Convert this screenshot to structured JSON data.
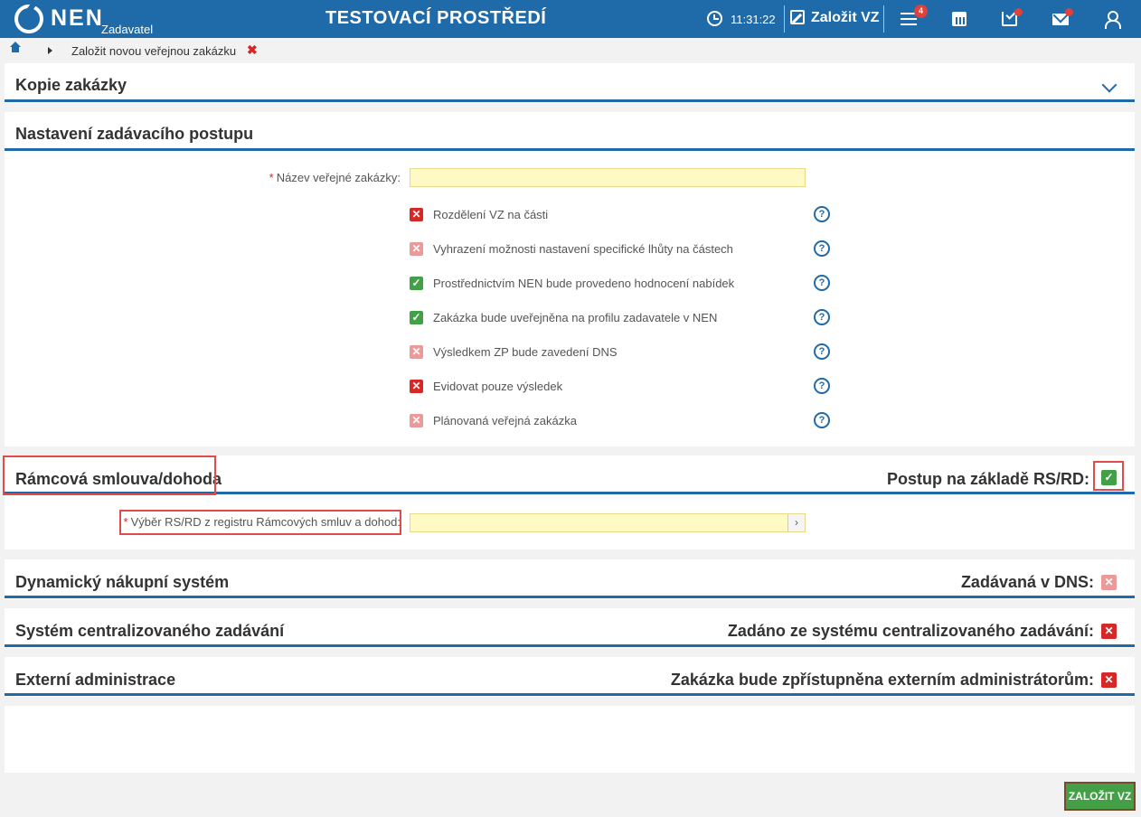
{
  "header": {
    "brand": "NEN",
    "brand_sub": "Zadavatel",
    "environment": "TESTOVACÍ PROSTŘEDÍ",
    "time": "11:31:22",
    "create_label": "Založit VZ",
    "menu_badge": "4",
    "colors": {
      "bar": "#1f6aa8",
      "notification": "#e0413a"
    }
  },
  "breadcrumb": {
    "current": "Založit novou veřejnou zakázku",
    "close": "✖"
  },
  "sections": {
    "copy": {
      "title": "Kopie zakázky"
    },
    "settings": {
      "title": "Nastavení zadávacího postupu",
      "name_label": "Název veřejné zakázky:",
      "name_value": "",
      "options": [
        {
          "label": "Rozdělení VZ na části",
          "state": "red"
        },
        {
          "label": "Vyhrazení možnosti nastavení specifické lhůty na částech",
          "state": "pink"
        },
        {
          "label": "Prostřednictvím NEN bude provedeno hodnocení nabídek",
          "state": "green"
        },
        {
          "label": "Zakázka bude uveřejněna na profilu zadavatele v NEN",
          "state": "green"
        },
        {
          "label": "Výsledkem ZP bude zavedení DNS",
          "state": "pink"
        },
        {
          "label": "Evidovat pouze výsledek",
          "state": "red"
        },
        {
          "label": "Plánovaná veřejná zakázka",
          "state": "pink"
        }
      ]
    },
    "framework": {
      "title": "Rámcová smlouva/dohoda",
      "right_label": "Postup na základě RS/RD:",
      "right_state": "green",
      "select_label": "Výběr RS/RD z registru Rámcových smluv a dohod:",
      "select_value": ""
    },
    "dns": {
      "title": "Dynamický nákupní systém",
      "right_label": "Zadávaná v DNS:",
      "right_state": "pink"
    },
    "central": {
      "title": "Systém centralizovaného zadávání",
      "right_label": "Zadáno ze systému centralizovaného zadávání:",
      "right_state": "red"
    },
    "external": {
      "title": "Externí administrace",
      "right_label": "Zakázka bude zpřístupněna externím administrátorům:",
      "right_state": "red"
    }
  },
  "footer": {
    "submit_label": "ZALOŽIT VZ"
  }
}
